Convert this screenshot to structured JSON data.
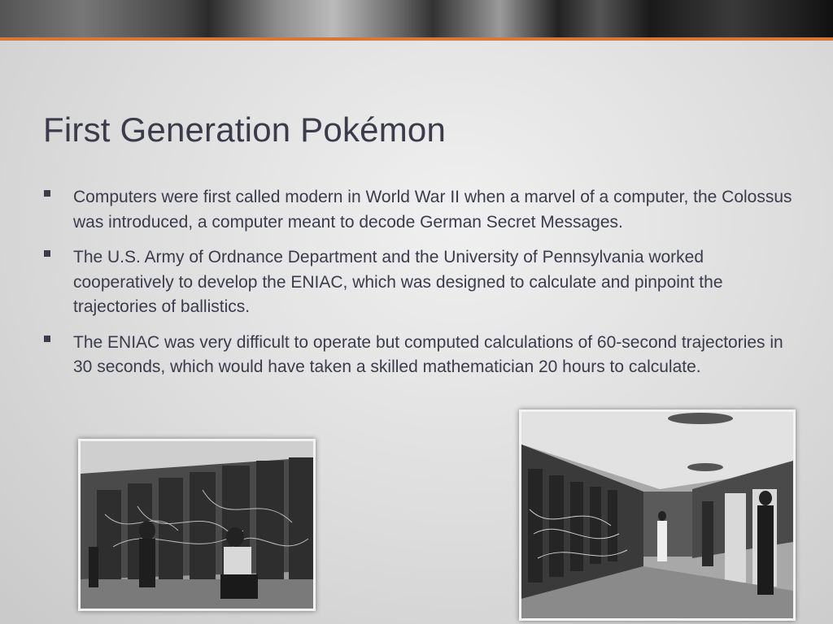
{
  "slide": {
    "title": "First Generation Pokémon",
    "bullets": [
      "Computers were first called modern in World War II when a marvel of a computer, the Colossus was introduced, a computer meant to decode German Secret Messages.",
      "The U.S. Army of Ordnance Department and the University of Pennsylvania worked cooperatively to develop the ENIAC, which was designed to calculate and pinpoint the trajectories of ballistics.",
      "The ENIAC was very difficult to operate but computed calculations of 60-second trajectories in 30 seconds, which would have taken a skilled mathematician 20 hours to calculate."
    ]
  },
  "colors": {
    "accent_rule": "#d4773a",
    "text": "#3b3b4c"
  }
}
